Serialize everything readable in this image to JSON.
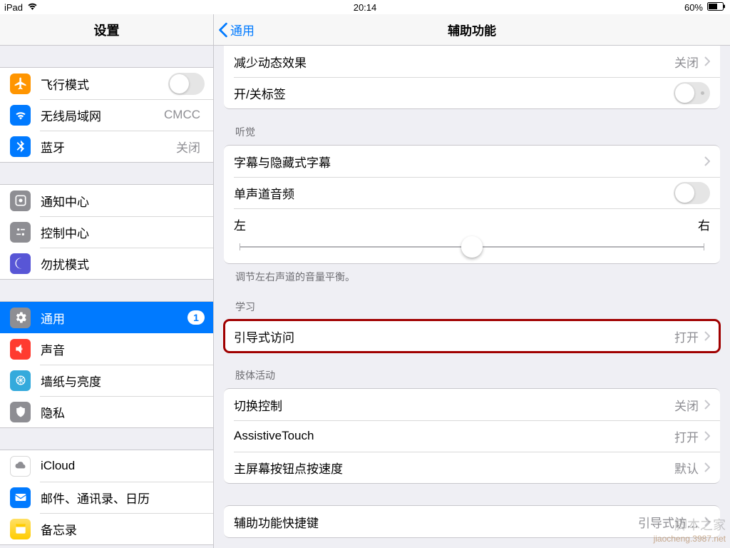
{
  "status": {
    "device": "iPad",
    "time": "20:14",
    "battery": "60%"
  },
  "sidebar": {
    "title": "设置",
    "g1": {
      "airplane": {
        "label": "飞行模式"
      },
      "wifi": {
        "label": "无线局域网",
        "value": "CMCC"
      },
      "bluetooth": {
        "label": "蓝牙",
        "value": "关闭"
      }
    },
    "g2": {
      "notif": {
        "label": "通知中心"
      },
      "control": {
        "label": "控制中心"
      },
      "dnd": {
        "label": "勿扰模式"
      }
    },
    "g3": {
      "general": {
        "label": "通用",
        "badge": "1"
      },
      "sound": {
        "label": "声音"
      },
      "wallpaper": {
        "label": "墙纸与亮度"
      },
      "privacy": {
        "label": "隐私"
      }
    },
    "g4": {
      "icloud": {
        "label": "iCloud"
      },
      "mail": {
        "label": "邮件、通讯录、日历"
      },
      "notes": {
        "label": "备忘录"
      }
    }
  },
  "detail": {
    "back": "通用",
    "title": "辅助功能",
    "top_group": {
      "reduce_motion": {
        "label": "减少动态效果",
        "value": "关闭"
      },
      "on_off_labels": {
        "label": "开/关标签"
      }
    },
    "hearing": {
      "header": "听觉",
      "subtitles": {
        "label": "字幕与隐藏式字幕"
      },
      "mono": {
        "label": "单声道音频"
      },
      "balance": {
        "left": "左",
        "right": "右"
      },
      "footer": "调节左右声道的音量平衡。"
    },
    "learning": {
      "header": "学习",
      "guided": {
        "label": "引导式访问",
        "value": "打开"
      }
    },
    "physical": {
      "header": "肢体活动",
      "switch": {
        "label": "切换控制",
        "value": "关闭"
      },
      "assistive": {
        "label": "AssistiveTouch",
        "value": "打开"
      },
      "home": {
        "label": "主屏幕按钮点按速度",
        "value": "默认"
      }
    },
    "bottom": {
      "shortcut": {
        "label": "辅助功能快捷键",
        "value": "引导式访…"
      }
    }
  },
  "watermark": {
    "upper": "脚本之家",
    "lower": "jiaocheng.3987.net"
  }
}
